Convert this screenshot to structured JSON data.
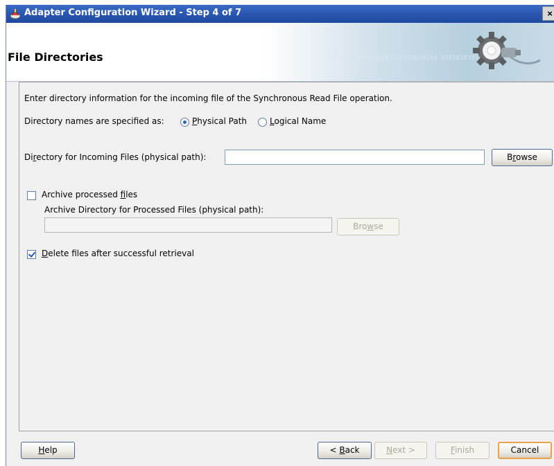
{
  "window": {
    "title": "Adapter Configuration Wizard - Step 4 of 7",
    "close_label": "×"
  },
  "header": {
    "heading": "File Directories",
    "banner_binary": "0101010101010101010101010101 0101010101010"
  },
  "content": {
    "intro": "Enter directory information for the incoming file of the Synchronous Read File operation.",
    "dir_spec_label": "Directory names are specified as:",
    "radio_physical": {
      "pre": "",
      "key": "P",
      "post": "hysical Path",
      "selected": true
    },
    "radio_logical": {
      "pre": "",
      "key": "L",
      "post": "ogical Name",
      "selected": false
    },
    "incoming": {
      "label_pre": "Di",
      "label_key": "r",
      "label_post": "ectory for Incoming Files (physical path):",
      "value": "",
      "browse_pre": "B",
      "browse_key": "r",
      "browse_post": "owse"
    },
    "archive_checkbox": {
      "pre": "Archive processed ",
      "key": "f",
      "post": "iles",
      "checked": false
    },
    "archive_dir": {
      "label": "Archive Directory for Processed Files (physical path):",
      "value": "",
      "browse_pre": "Bro",
      "browse_key": "w",
      "browse_post": "se"
    },
    "delete_checkbox": {
      "pre": "",
      "key": "D",
      "post": "elete files after successful retrieval",
      "checked": true
    }
  },
  "footer": {
    "help": {
      "pre": "",
      "key": "H",
      "post": "elp"
    },
    "back": {
      "pre": "< ",
      "key": "B",
      "post": "ack"
    },
    "next": {
      "pre": "",
      "key": "N",
      "post": "ext >"
    },
    "finish": {
      "pre": "",
      "key": "F",
      "post": "inish"
    },
    "cancel": "Cancel"
  },
  "colors": {
    "titlebar": "#2a57b0",
    "focus_border": "#e9a24a",
    "radio_selected": "#2a62c0"
  }
}
